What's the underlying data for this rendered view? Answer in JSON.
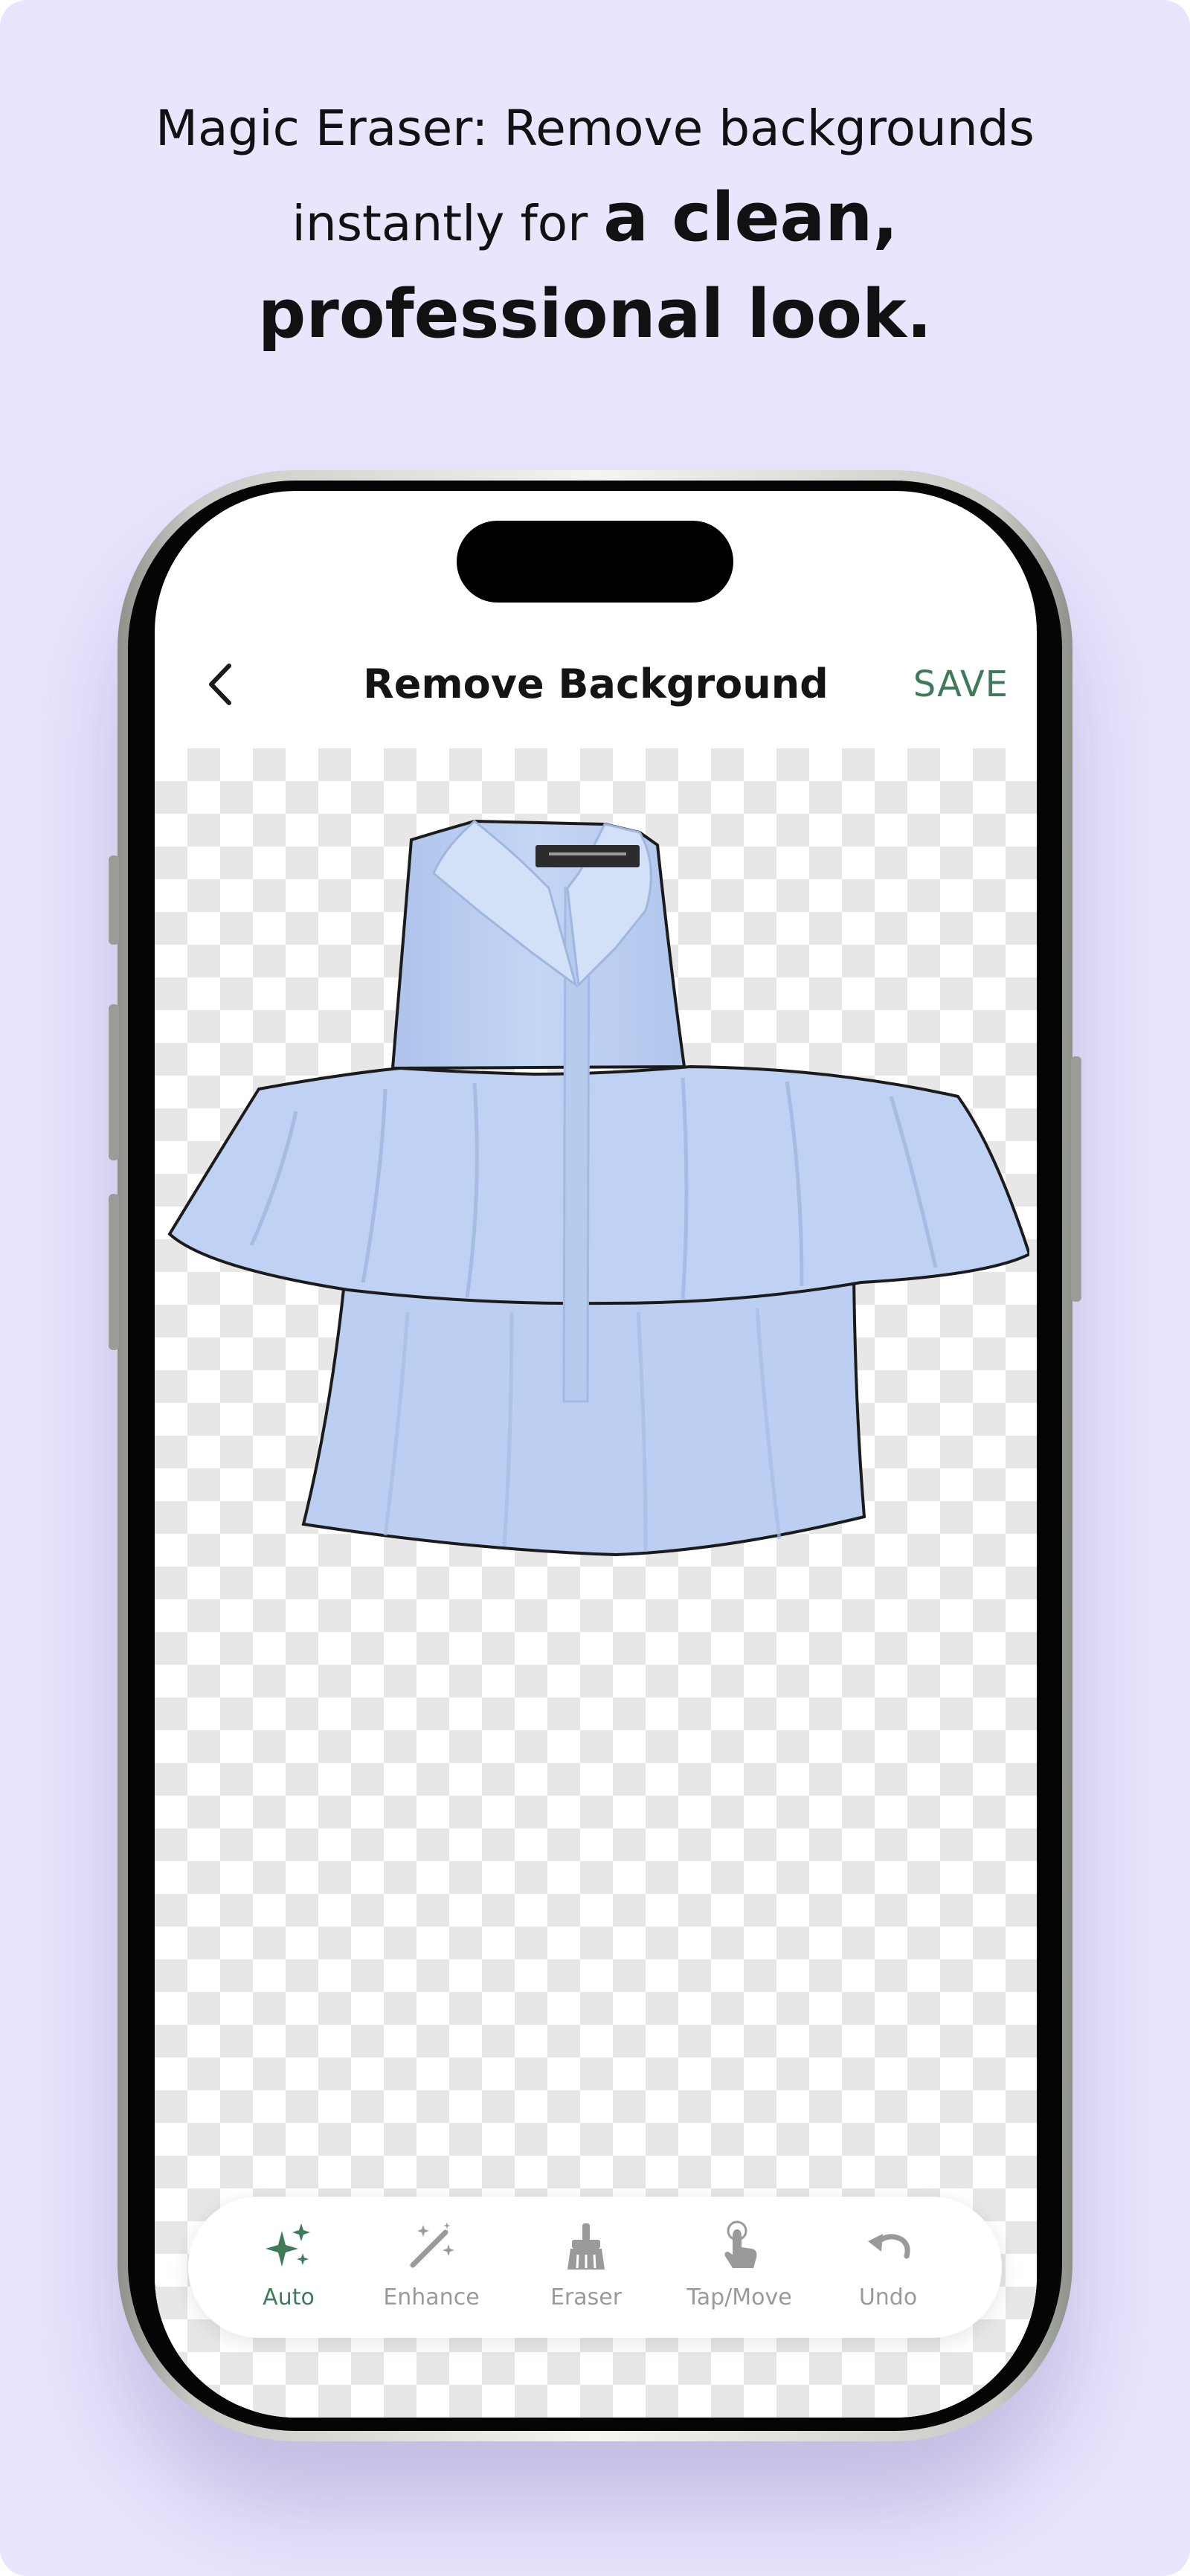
{
  "headline": {
    "line1": "Magic Eraser: Remove backgrounds",
    "line2_regular": "instantly for ",
    "line2_bold": "a clean,",
    "line3": "professional look."
  },
  "screen": {
    "title": "Remove Background",
    "back_icon": "chevron-left-icon",
    "save_label": "SAVE",
    "image": "light blue sleeveless ruffle blouse"
  },
  "toolbar": {
    "active": "Auto",
    "tools": [
      {
        "label": "Auto",
        "icon": "sparkles-icon"
      },
      {
        "label": "Enhance",
        "icon": "magic-wand-icon"
      },
      {
        "label": "Eraser",
        "icon": "eraser-brush-icon"
      },
      {
        "label": "Tap/Move",
        "icon": "tap-hand-icon"
      },
      {
        "label": "Undo",
        "icon": "undo-icon"
      }
    ]
  },
  "colors": {
    "background": "#e9e5fd",
    "accent": "#3f7a59",
    "inactive_tool": "#9a9a9a",
    "garment": "#bcd0f2"
  }
}
